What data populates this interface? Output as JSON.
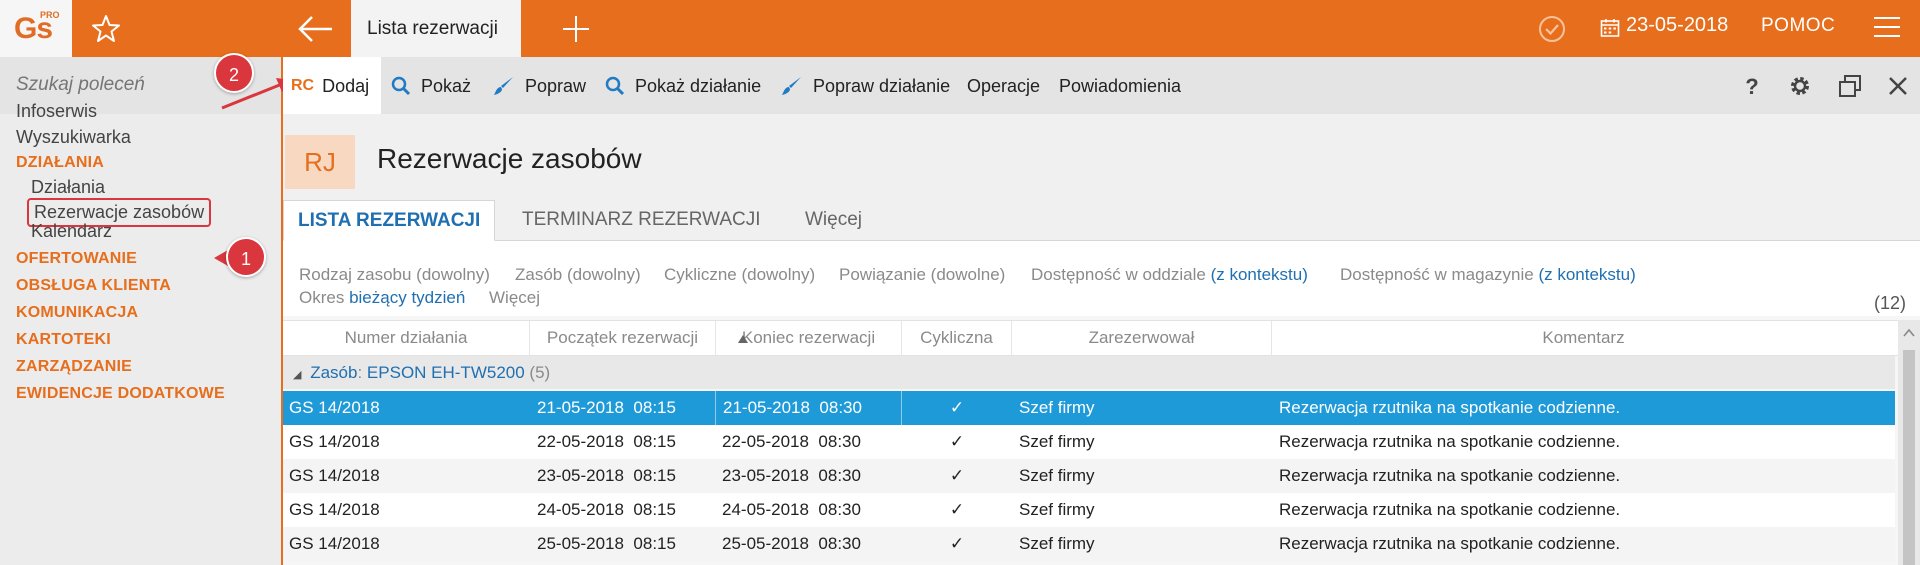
{
  "app": {
    "logo": "Gs",
    "logo_pro": "PRO",
    "tab_title": "Lista rezerwacji",
    "date": "23-05-2018",
    "help": "POMOC"
  },
  "sidebar": {
    "search_placeholder": "Szukaj poleceń",
    "items": [
      {
        "label": "Infoserwis"
      },
      {
        "label": "Wyszukiwarka"
      }
    ],
    "section_active": "DZIAŁANIA",
    "sub_items": [
      {
        "label": "Działania"
      },
      {
        "label": "Rezerwacje zasobów"
      },
      {
        "label": "Kalendarz"
      }
    ],
    "sections": [
      {
        "label": "OFERTOWANIE"
      },
      {
        "label": "OBSŁUGA KLIENTA"
      },
      {
        "label": "KOMUNIKACJA"
      },
      {
        "label": "KARTOTEKI"
      },
      {
        "label": "ZARZĄDZANIE"
      },
      {
        "label": "EWIDENCJE DODATKOWE"
      }
    ]
  },
  "callouts": {
    "one": "1",
    "two": "2"
  },
  "toolbar": {
    "add_code": "RC",
    "add": "Dodaj",
    "show": "Pokaż",
    "edit": "Popraw",
    "show_action": "Pokaż działanie",
    "edit_action": "Popraw działanie",
    "operations": "Operacje",
    "notifications": "Powiadomienia"
  },
  "header": {
    "badge": "RJ",
    "title": "Rezerwacje zasobów"
  },
  "tabs": [
    {
      "label": "LISTA REZERWACJI"
    },
    {
      "label": "TERMINARZ REZERWACJI"
    },
    {
      "label": "Więcej"
    }
  ],
  "filters": {
    "resource_type": "Rodzaj zasobu (dowolny)",
    "resource": "Zasób (dowolny)",
    "cyclic": "Cykliczne (dowolny)",
    "link": "Powiązanie (dowolne)",
    "branch_label": "Dostępność w oddziale",
    "branch_value": "(z kontekstu)",
    "warehouse_label": "Dostępność w magazynie",
    "warehouse_value": "(z kontekstu)",
    "period_label": "Okres",
    "period_value": "bieżący tydzień",
    "more": "Więcej",
    "count": "(12)"
  },
  "grid": {
    "columns": [
      "Numer działania",
      "Początek rezerwacji",
      "Koniec rezerwacji",
      "Cykliczna",
      "Zarezerwował",
      "Komentarz"
    ],
    "group": {
      "label": "Zasób",
      "value": "EPSON EH-TW5200",
      "count": "(5)"
    },
    "rows": [
      {
        "number": "GS 14/2018",
        "start_date": "21-05-2018",
        "start_time": "08:15",
        "end_date": "21-05-2018",
        "end_time": "08:30",
        "cyclic": "✓",
        "reserved_by": "Szef firmy",
        "comment": "Rezerwacja rzutnika na spotkanie codzienne."
      },
      {
        "number": "GS 14/2018",
        "start_date": "22-05-2018",
        "start_time": "08:15",
        "end_date": "22-05-2018",
        "end_time": "08:30",
        "cyclic": "✓",
        "reserved_by": "Szef firmy",
        "comment": "Rezerwacja rzutnika na spotkanie codzienne."
      },
      {
        "number": "GS 14/2018",
        "start_date": "23-05-2018",
        "start_time": "08:15",
        "end_date": "23-05-2018",
        "end_time": "08:30",
        "cyclic": "✓",
        "reserved_by": "Szef firmy",
        "comment": "Rezerwacja rzutnika na spotkanie codzienne."
      },
      {
        "number": "GS 14/2018",
        "start_date": "24-05-2018",
        "start_time": "08:15",
        "end_date": "24-05-2018",
        "end_time": "08:30",
        "cyclic": "✓",
        "reserved_by": "Szef firmy",
        "comment": "Rezerwacja rzutnika na spotkanie codzienne."
      },
      {
        "number": "GS 14/2018",
        "start_date": "25-05-2018",
        "start_time": "08:15",
        "end_date": "25-05-2018",
        "end_time": "08:30",
        "cyclic": "✓",
        "reserved_by": "Szef firmy",
        "comment": "Rezerwacja rzutnika na spotkanie codzienne."
      }
    ]
  },
  "colors": {
    "accent": "#e66e1c",
    "link": "#1f6fb1",
    "selection": "#1f9ad9",
    "callout": "#d9363e"
  }
}
